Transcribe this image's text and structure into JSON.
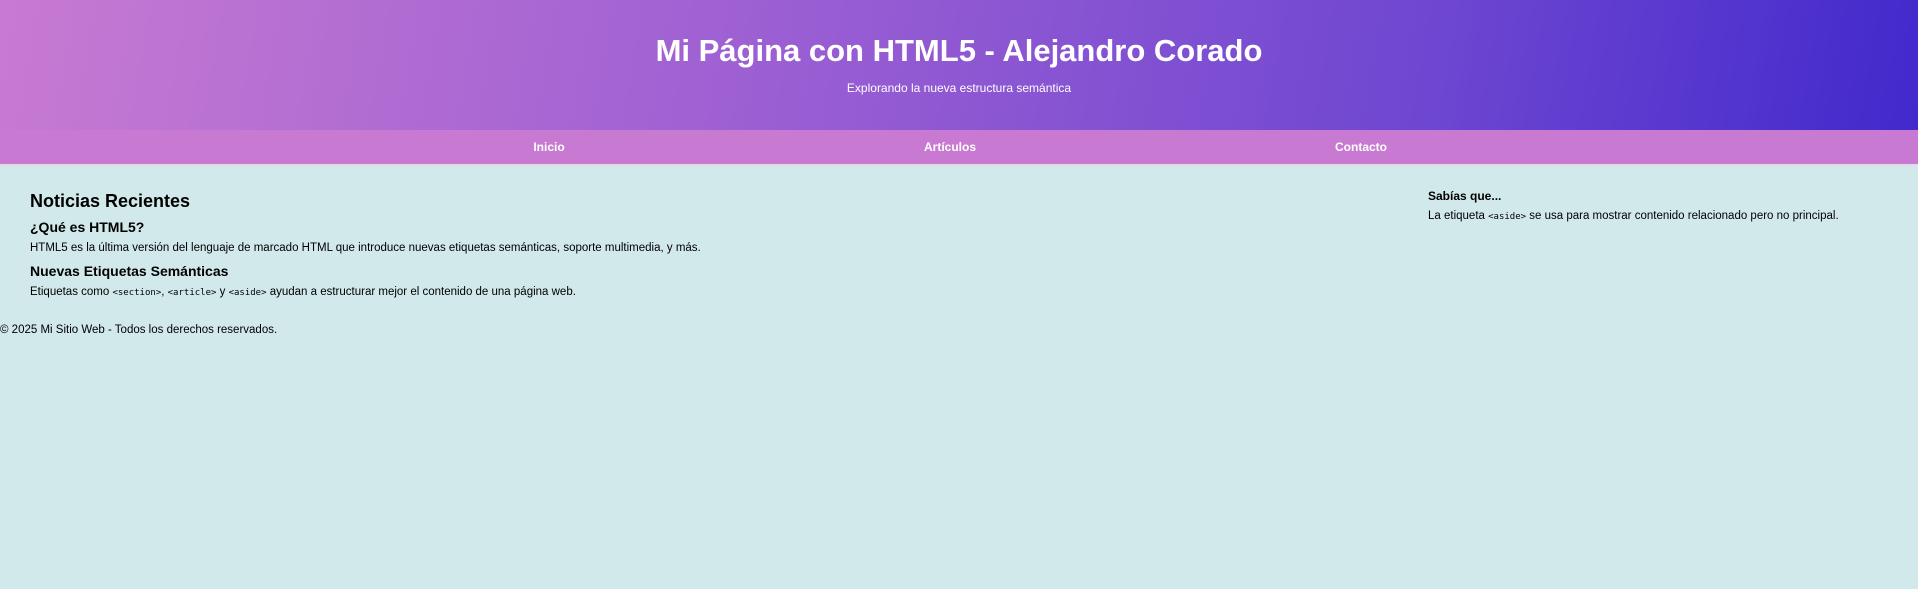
{
  "header": {
    "title": "Mi Página con HTML5 - Alejandro Corado",
    "subtitle": "Explorando la nueva estructura semántica"
  },
  "nav": {
    "items": [
      {
        "label": "Inicio"
      },
      {
        "label": "Artículos"
      },
      {
        "label": "Contacto"
      }
    ]
  },
  "main": {
    "heading": "Noticias Recientes",
    "articles": [
      {
        "title": "¿Qué es HTML5?",
        "body": "HTML5 es la última versión del lenguaje de marcado HTML que introduce nuevas etiquetas semánticas, soporte multimedia, y más."
      },
      {
        "title": "Nuevas Etiquetas Semánticas",
        "body_prefix": "Etiquetas como ",
        "code_section": "<section>",
        "sep1": ", ",
        "code_article": "<article>",
        "sep2": " y ",
        "code_aside": "<aside>",
        "body_suffix": " ayudan a estructurar mejor el contenido de una página web."
      }
    ]
  },
  "aside": {
    "heading": "Sabías que...",
    "text_prefix": "La etiqueta ",
    "code": "<aside>",
    "text_suffix": " se usa para mostrar contenido relacionado pero no principal."
  },
  "footer": {
    "text": "© 2025 Mi Sitio Web - Todos los derechos reservados."
  },
  "colors": {
    "background": "#d1e9eb",
    "header_gradient_start": "#c77ad2",
    "header_gradient_end": "#4229cc",
    "nav_background": "#c87ad2"
  }
}
